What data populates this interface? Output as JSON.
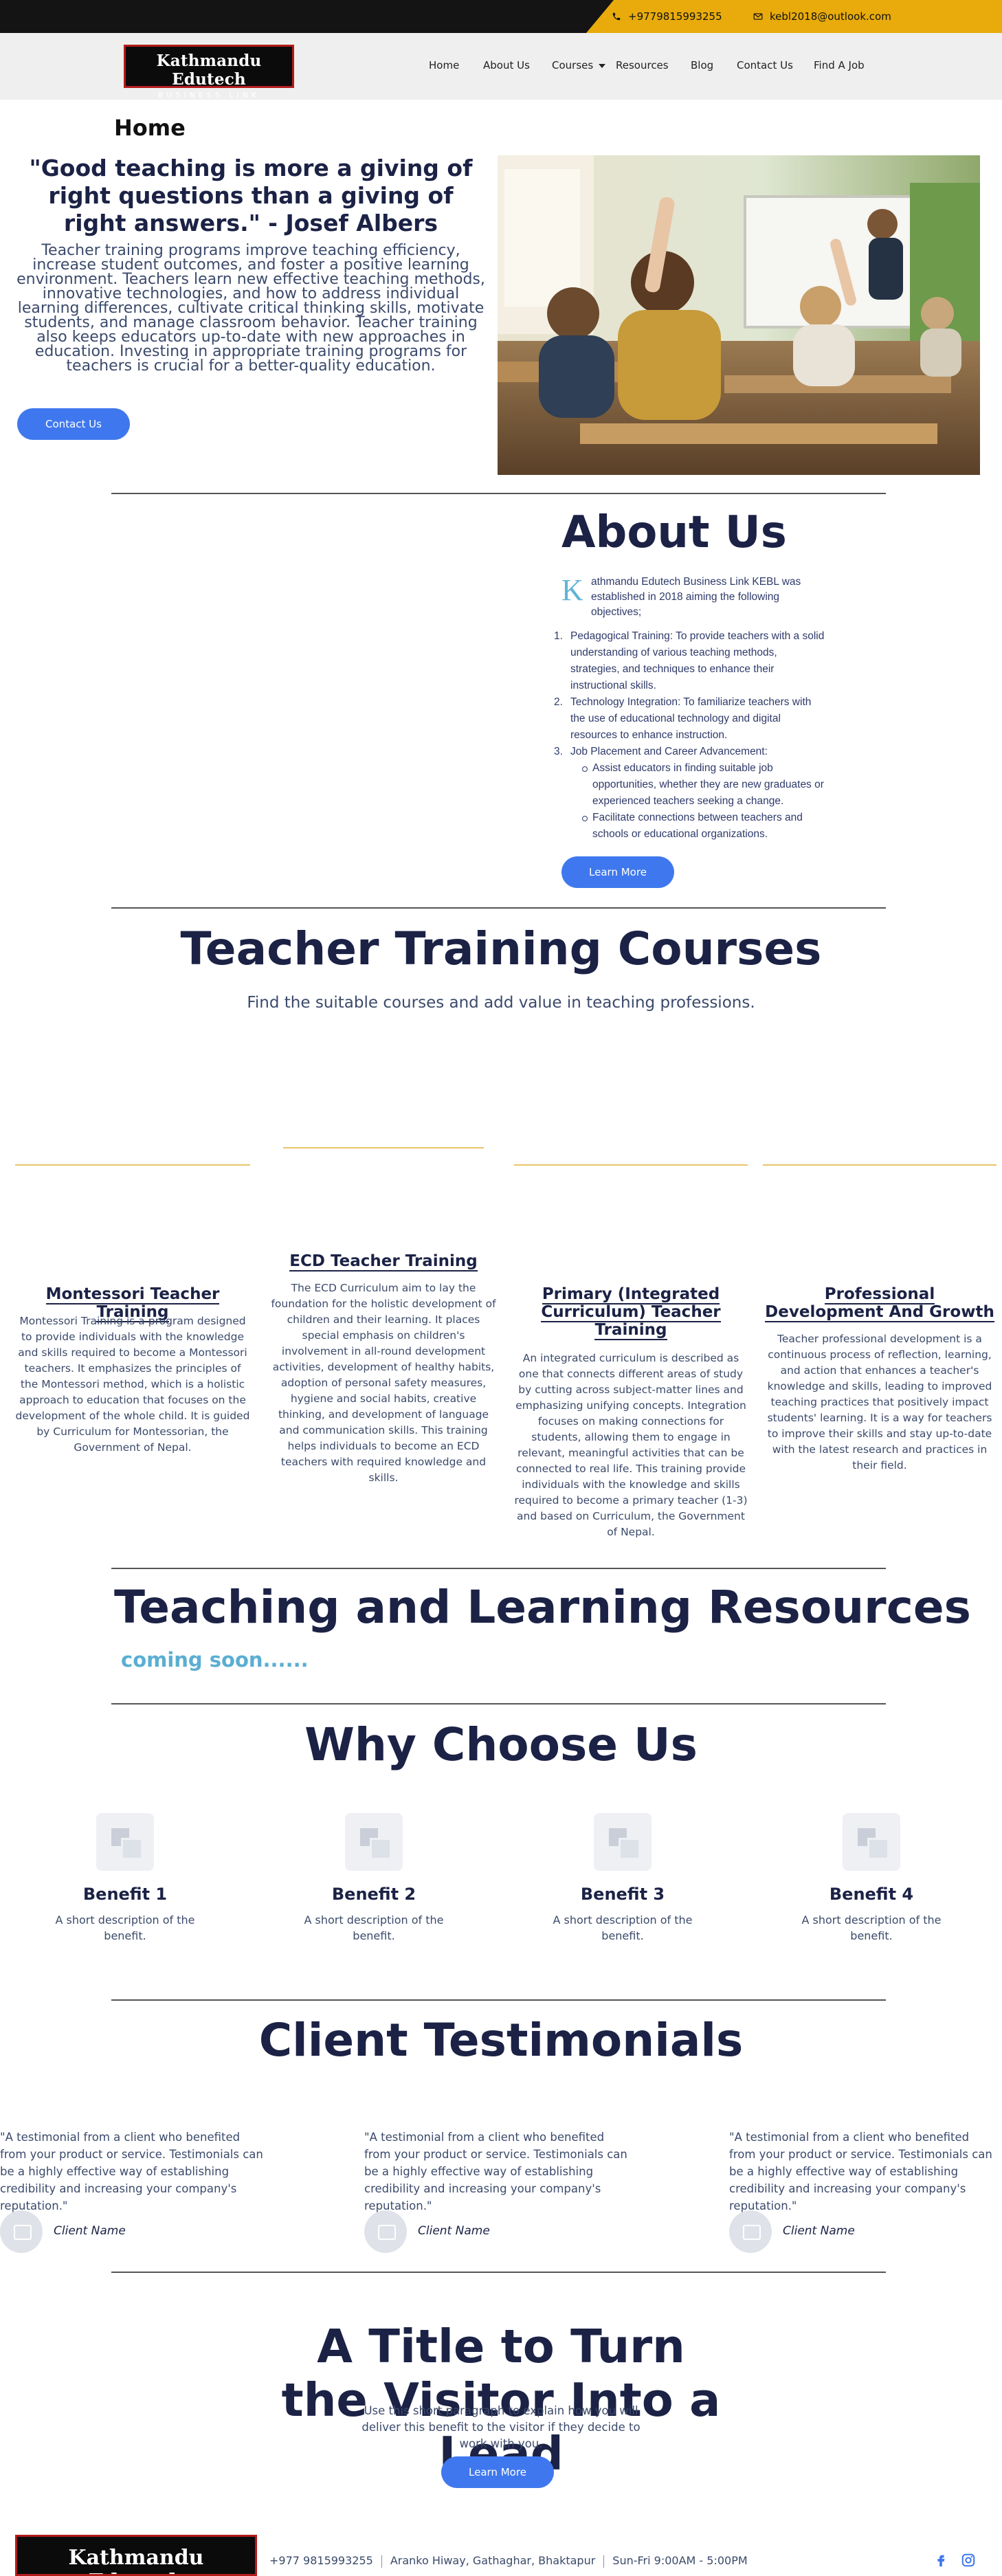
{
  "topbar": {
    "phone": "+9779815993255",
    "email": "kebl2018@outlook.com"
  },
  "brand": {
    "name": "Kathmandu Edutech",
    "tagline": "BUSINESS LINK"
  },
  "nav": {
    "items": [
      "Home",
      "About Us",
      "Courses",
      "Resources",
      "Blog",
      "Contact Us",
      "Find A Job"
    ]
  },
  "hero": {
    "page_title": "Home",
    "quote": "\"Good teaching is more a giving of right questions than a giving of right answers.\" - Josef Albers",
    "paragraph": "Teacher training programs improve teaching efficiency, increase student outcomes, and foster a positive learning environment. Teachers learn new effective teaching methods, innovative technologies, and how to address individual learning differences, cultivate critical thinking skills, motivate students, and manage classroom behavior. Teacher training also keeps educators up-to-date with new approaches in education. Investing in appropriate training programs for teachers is crucial for a better-quality education.",
    "button": "Contact Us"
  },
  "about": {
    "title": "About Us",
    "drop_cap": "K",
    "intro": "athmandu Edutech Business Link KEBL was established in 2018 aiming the following objectives;",
    "objectives": [
      "Pedagogical Training: To provide teachers with a solid understanding of various teaching methods, strategies, and techniques to enhance their instructional skills.",
      "Technology Integration: To familiarize teachers with the use of educational technology and digital resources to enhance instruction.",
      "Job Placement and Career Advancement:"
    ],
    "sub_items": [
      "Assist educators in finding suitable job opportunities, whether they are new graduates or experienced teachers seeking a change.",
      "Facilitate connections between teachers and schools or educational organizations."
    ],
    "button": "Learn More"
  },
  "courses": {
    "title": "Teacher Training Courses",
    "subtitle": "Find the suitable courses and add value in teaching professions.",
    "items": [
      {
        "title": "Montessori Teacher Training",
        "text": "Montessori Training is a program designed to provide individuals with the knowledge and skills required to become a Montessori teachers. It emphasizes the principles of the Montessori method, which is a holistic approach to education that focuses on the development of the whole child. It is guided by Curriculum for Montessorian, the Government of Nepal."
      },
      {
        "title": "ECD Teacher Training",
        "text": "The ECD Curriculum aim to lay the foundation for the holistic development of children and their learning. It places special emphasis on children's involvement in all-round development activities, development of healthy habits, adoption of personal safety measures, hygiene and social habits, creative thinking, and development of language and communication skills. This training helps individuals to become an ECD teachers with required knowledge and skills."
      },
      {
        "title": "Primary (Integrated Curriculum) Teacher Training",
        "text": "An integrated curriculum is described as one that connects different areas of study by cutting across subject-matter lines and emphasizing unifying concepts. Integration focuses on making connections for students, allowing them to engage in relevant, meaningful activities that can be connected to real life. This training provide individuals with the knowledge and skills required to become a primary teacher (1-3) and based on Curriculum, the Government of Nepal."
      },
      {
        "title": "Professional Development And Growth",
        "text": "Teacher professional development is a continuous process of reflection, learning, and action that enhances a teacher's knowledge and skills, leading to improved teaching practices that positively impact students' learning. It is a way for teachers to improve their skills and stay up-to-date with the latest research and practices in their field."
      }
    ]
  },
  "resources": {
    "title": "Teaching and Learning Resources",
    "status": "coming soon......"
  },
  "why": {
    "title": "Why Choose Us",
    "benefits": [
      {
        "title": "Benefit 1",
        "text": "A short description of the benefit."
      },
      {
        "title": "Benefit 2",
        "text": "A short description of the benefit."
      },
      {
        "title": "Benefit 3",
        "text": "A short description of the benefit."
      },
      {
        "title": "Benefit 4",
        "text": "A short description of the benefit."
      }
    ]
  },
  "testimonials": {
    "title": "Client Testimonials",
    "items": [
      {
        "text": "\"A testimonial from a client who benefited from your product or service. Testimonials can be a highly effective way of establishing credibility and increasing your company's reputation.\"",
        "name": "Client Name"
      },
      {
        "text": "\"A testimonial from a client who benefited from your product or service. Testimonials can be a highly effective way of establishing credibility and increasing your company's reputation.\"",
        "name": "Client Name"
      },
      {
        "text": "\"A testimonial from a client who benefited from your product or service. Testimonials can be a highly effective way of establishing credibility and increasing your company's reputation.\"",
        "name": "Client Name"
      }
    ]
  },
  "cta": {
    "title": "A Title to Turn the Visitor Into a Lead",
    "text": "Use this short paragraph to explain how you will deliver this benefit to the visitor if they decide to work with you.",
    "button": "Learn More"
  },
  "footer": {
    "phone": "+977 9815993255",
    "address": "Aranko Hiway, Gathaghar, Bhaktapur",
    "hours": "Sun-Fri 9:00AM - 5:00PM"
  },
  "colors": {
    "accent_yellow": "#e8ab0b",
    "button_blue": "#3f78ee",
    "heading_navy": "#1b2245",
    "coming_soon": "#5aaed2"
  }
}
